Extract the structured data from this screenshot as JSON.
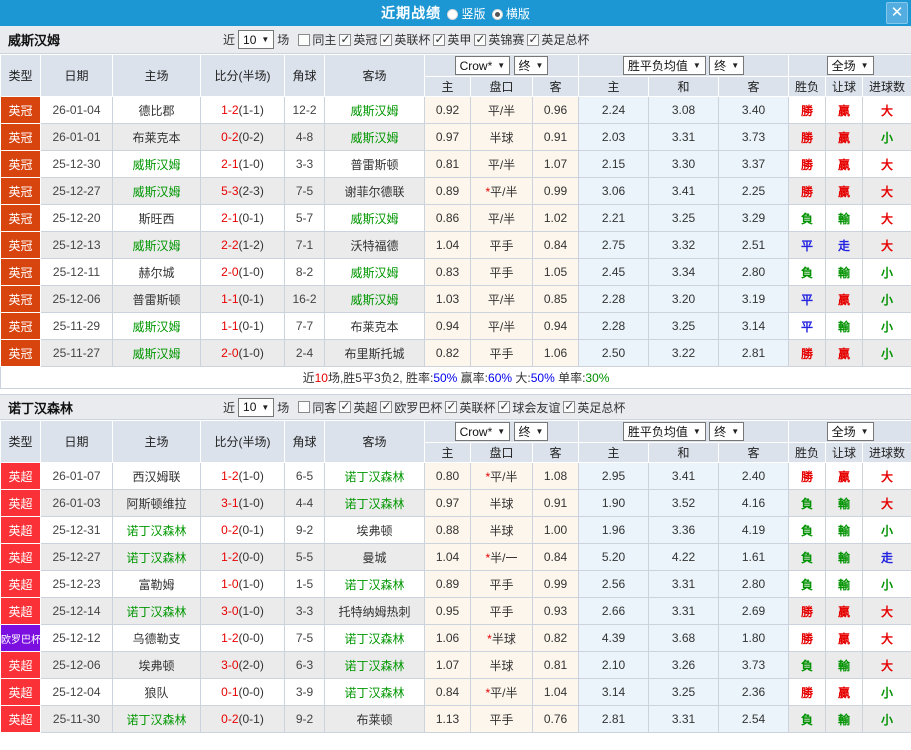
{
  "titlebar": {
    "title": "近期战绩",
    "radio_vertical": "竖版",
    "radio_horizontal": "横版",
    "close_glyph": "✕"
  },
  "table_header": {
    "cols": [
      "类型",
      "日期",
      "主场",
      "比分(半场)",
      "角球",
      "客场"
    ],
    "sub": [
      "主",
      "盘口",
      "客",
      "主",
      "和",
      "客",
      "胜负",
      "让球",
      "进球数"
    ],
    "dd_company": "Crow*",
    "dd_final1": "终",
    "dd_avg": "胜平负均值",
    "dd_final2": "终",
    "dd_scope": "全场"
  },
  "palette": {
    "topbar": "#1d97d4",
    "header_bg": "#dbe2ec",
    "team_green": "#009700",
    "score_red": "#e80000",
    "leagues": {
      "英冠": "#d8440e",
      "英超": "#fa3238",
      "欧罗巴杯": "#7a0fe0"
    },
    "outcome": {
      "勝": "#e60000",
      "負": "#009200",
      "平": "#2222e0",
      "贏": "#e60000",
      "輸": "#009200",
      "走": "#2222e0",
      "大": "#e60000",
      "小": "#009200"
    }
  },
  "sections": [
    {
      "team": "威斯汉姆",
      "filter": {
        "prefix": "近",
        "count": "10",
        "suffix": "场",
        "same_label": "同主",
        "leagues": [
          "英冠",
          "英联杯",
          "英甲",
          "英锦赛",
          "英足总杯"
        ]
      },
      "rows": [
        {
          "league": "英冠",
          "date": "26-01-04",
          "home": "德比郡",
          "hg": false,
          "score": "1-2",
          "half": "(1-1)",
          "corner": "12-2",
          "away": "威斯汉姆",
          "ag": true,
          "h": "0.92",
          "hcp": "平/半",
          "star": false,
          "a": "0.96",
          "ah": "2.24",
          "ad": "3.08",
          "aa": "3.40",
          "r1": "勝",
          "r2": "贏",
          "r3": "大"
        },
        {
          "league": "英冠",
          "date": "26-01-01",
          "home": "布莱克本",
          "hg": false,
          "score": "0-2",
          "half": "(0-2)",
          "corner": "4-8",
          "away": "威斯汉姆",
          "ag": true,
          "h": "0.97",
          "hcp": "半球",
          "star": false,
          "a": "0.91",
          "ah": "2.03",
          "ad": "3.31",
          "aa": "3.73",
          "r1": "勝",
          "r2": "贏",
          "r3": "小"
        },
        {
          "league": "英冠",
          "date": "25-12-30",
          "home": "威斯汉姆",
          "hg": true,
          "score": "2-1",
          "half": "(1-0)",
          "corner": "3-3",
          "away": "普雷斯顿",
          "ag": false,
          "h": "0.81",
          "hcp": "平/半",
          "star": false,
          "a": "1.07",
          "ah": "2.15",
          "ad": "3.30",
          "aa": "3.37",
          "r1": "勝",
          "r2": "贏",
          "r3": "大"
        },
        {
          "league": "英冠",
          "date": "25-12-27",
          "home": "威斯汉姆",
          "hg": true,
          "score": "5-3",
          "half": "(2-3)",
          "corner": "7-5",
          "away": "谢菲尔德联",
          "ag": false,
          "h": "0.89",
          "hcp": "平/半",
          "star": true,
          "a": "0.99",
          "ah": "3.06",
          "ad": "3.41",
          "aa": "2.25",
          "r1": "勝",
          "r2": "贏",
          "r3": "大"
        },
        {
          "league": "英冠",
          "date": "25-12-20",
          "home": "斯旺西",
          "hg": false,
          "score": "2-1",
          "half": "(0-1)",
          "corner": "5-7",
          "away": "威斯汉姆",
          "ag": true,
          "h": "0.86",
          "hcp": "平/半",
          "star": false,
          "a": "1.02",
          "ah": "2.21",
          "ad": "3.25",
          "aa": "3.29",
          "r1": "負",
          "r2": "輸",
          "r3": "大"
        },
        {
          "league": "英冠",
          "date": "25-12-13",
          "home": "威斯汉姆",
          "hg": true,
          "score": "2-2",
          "half": "(1-2)",
          "corner": "7-1",
          "away": "沃特福德",
          "ag": false,
          "h": "1.04",
          "hcp": "平手",
          "star": false,
          "a": "0.84",
          "ah": "2.75",
          "ad": "3.32",
          "aa": "2.51",
          "r1": "平",
          "r2": "走",
          "r3": "大"
        },
        {
          "league": "英冠",
          "date": "25-12-11",
          "home": "赫尔城",
          "hg": false,
          "score": "2-0",
          "half": "(1-0)",
          "corner": "8-2",
          "away": "威斯汉姆",
          "ag": true,
          "h": "0.83",
          "hcp": "平手",
          "star": false,
          "a": "1.05",
          "ah": "2.45",
          "ad": "3.34",
          "aa": "2.80",
          "r1": "負",
          "r2": "輸",
          "r3": "小"
        },
        {
          "league": "英冠",
          "date": "25-12-06",
          "home": "普雷斯顿",
          "hg": false,
          "score": "1-1",
          "half": "(0-1)",
          "corner": "16-2",
          "away": "威斯汉姆",
          "ag": true,
          "h": "1.03",
          "hcp": "平/半",
          "star": false,
          "a": "0.85",
          "ah": "2.28",
          "ad": "3.20",
          "aa": "3.19",
          "r1": "平",
          "r2": "贏",
          "r3": "小"
        },
        {
          "league": "英冠",
          "date": "25-11-29",
          "home": "威斯汉姆",
          "hg": true,
          "score": "1-1",
          "half": "(0-1)",
          "corner": "7-7",
          "away": "布莱克本",
          "ag": false,
          "h": "0.94",
          "hcp": "平/半",
          "star": false,
          "a": "0.94",
          "ah": "2.28",
          "ad": "3.25",
          "aa": "3.14",
          "r1": "平",
          "r2": "輸",
          "r3": "小"
        },
        {
          "league": "英冠",
          "date": "25-11-27",
          "home": "威斯汉姆",
          "hg": true,
          "score": "2-0",
          "half": "(1-0)",
          "corner": "2-4",
          "away": "布里斯托城",
          "ag": false,
          "h": "0.82",
          "hcp": "平手",
          "star": false,
          "a": "1.06",
          "ah": "2.50",
          "ad": "3.22",
          "aa": "2.81",
          "r1": "勝",
          "r2": "贏",
          "r3": "小"
        }
      ],
      "summary": [
        {
          "t": "近",
          "c": "#333333"
        },
        {
          "t": "10",
          "c": "#e80000"
        },
        {
          "t": "场,胜5平3负2, 胜率:",
          "c": "#333333"
        },
        {
          "t": "50%",
          "c": "#0000ee"
        },
        {
          "t": " 赢率:",
          "c": "#333333"
        },
        {
          "t": "60%",
          "c": "#0000ee"
        },
        {
          "t": " 大:",
          "c": "#333333"
        },
        {
          "t": "50%",
          "c": "#0000ee"
        },
        {
          "t": " 单率:",
          "c": "#333333"
        },
        {
          "t": "30%",
          "c": "#009200"
        }
      ]
    },
    {
      "team": "诺丁汉森林",
      "filter": {
        "prefix": "近",
        "count": "10",
        "suffix": "场",
        "same_label": "同客",
        "leagues": [
          "英超",
          "欧罗巴杯",
          "英联杯",
          "球会友谊",
          "英足总杯"
        ]
      },
      "rows": [
        {
          "league": "英超",
          "date": "26-01-07",
          "home": "西汉姆联",
          "hg": false,
          "score": "1-2",
          "half": "(1-0)",
          "corner": "6-5",
          "away": "诺丁汉森林",
          "ag": true,
          "h": "0.80",
          "hcp": "平/半",
          "star": true,
          "a": "1.08",
          "ah": "2.95",
          "ad": "3.41",
          "aa": "2.40",
          "r1": "勝",
          "r2": "贏",
          "r3": "大"
        },
        {
          "league": "英超",
          "date": "26-01-03",
          "home": "阿斯顿维拉",
          "hg": false,
          "score": "3-1",
          "half": "(1-0)",
          "corner": "4-4",
          "away": "诺丁汉森林",
          "ag": true,
          "h": "0.97",
          "hcp": "半球",
          "star": false,
          "a": "0.91",
          "ah": "1.90",
          "ad": "3.52",
          "aa": "4.16",
          "r1": "負",
          "r2": "輸",
          "r3": "大"
        },
        {
          "league": "英超",
          "date": "25-12-31",
          "home": "诺丁汉森林",
          "hg": true,
          "score": "0-2",
          "half": "(0-1)",
          "corner": "9-2",
          "away": "埃弗顿",
          "ag": false,
          "h": "0.88",
          "hcp": "半球",
          "star": false,
          "a": "1.00",
          "ah": "1.96",
          "ad": "3.36",
          "aa": "4.19",
          "r1": "負",
          "r2": "輸",
          "r3": "小"
        },
        {
          "league": "英超",
          "date": "25-12-27",
          "home": "诺丁汉森林",
          "hg": true,
          "score": "1-2",
          "half": "(0-0)",
          "corner": "5-5",
          "away": "曼城",
          "ag": false,
          "h": "1.04",
          "hcp": "半/一",
          "star": true,
          "a": "0.84",
          "ah": "5.20",
          "ad": "4.22",
          "aa": "1.61",
          "r1": "負",
          "r2": "輸",
          "r3": "走"
        },
        {
          "league": "英超",
          "date": "25-12-23",
          "home": "富勒姆",
          "hg": false,
          "score": "1-0",
          "half": "(1-0)",
          "corner": "1-5",
          "away": "诺丁汉森林",
          "ag": true,
          "h": "0.89",
          "hcp": "平手",
          "star": false,
          "a": "0.99",
          "ah": "2.56",
          "ad": "3.31",
          "aa": "2.80",
          "r1": "負",
          "r2": "輸",
          "r3": "小"
        },
        {
          "league": "英超",
          "date": "25-12-14",
          "home": "诺丁汉森林",
          "hg": true,
          "score": "3-0",
          "half": "(1-0)",
          "corner": "3-3",
          "away": "托特纳姆热刺",
          "ag": false,
          "h": "0.95",
          "hcp": "平手",
          "star": false,
          "a": "0.93",
          "ah": "2.66",
          "ad": "3.31",
          "aa": "2.69",
          "r1": "勝",
          "r2": "贏",
          "r3": "大"
        },
        {
          "league": "欧罗巴杯",
          "date": "25-12-12",
          "home": "乌德勒支",
          "hg": false,
          "score": "1-2",
          "half": "(0-0)",
          "corner": "7-5",
          "away": "诺丁汉森林",
          "ag": true,
          "h": "1.06",
          "hcp": "半球",
          "star": true,
          "a": "0.82",
          "ah": "4.39",
          "ad": "3.68",
          "aa": "1.80",
          "r1": "勝",
          "r2": "贏",
          "r3": "大"
        },
        {
          "league": "英超",
          "date": "25-12-06",
          "home": "埃弗顿",
          "hg": false,
          "score": "3-0",
          "half": "(2-0)",
          "corner": "6-3",
          "away": "诺丁汉森林",
          "ag": true,
          "h": "1.07",
          "hcp": "半球",
          "star": false,
          "a": "0.81",
          "ah": "2.10",
          "ad": "3.26",
          "aa": "3.73",
          "r1": "負",
          "r2": "輸",
          "r3": "大"
        },
        {
          "league": "英超",
          "date": "25-12-04",
          "home": "狼队",
          "hg": false,
          "score": "0-1",
          "half": "(0-0)",
          "corner": "3-9",
          "away": "诺丁汉森林",
          "ag": true,
          "h": "0.84",
          "hcp": "平/半",
          "star": true,
          "a": "1.04",
          "ah": "3.14",
          "ad": "3.25",
          "aa": "2.36",
          "r1": "勝",
          "r2": "贏",
          "r3": "小"
        },
        {
          "league": "英超",
          "date": "25-11-30",
          "home": "诺丁汉森林",
          "hg": true,
          "score": "0-2",
          "half": "(0-1)",
          "corner": "9-2",
          "away": "布莱顿",
          "ag": false,
          "h": "1.13",
          "hcp": "平手",
          "star": false,
          "a": "0.76",
          "ah": "2.81",
          "ad": "3.31",
          "aa": "2.54",
          "r1": "負",
          "r2": "輸",
          "r3": "小"
        }
      ],
      "summary": null
    }
  ]
}
